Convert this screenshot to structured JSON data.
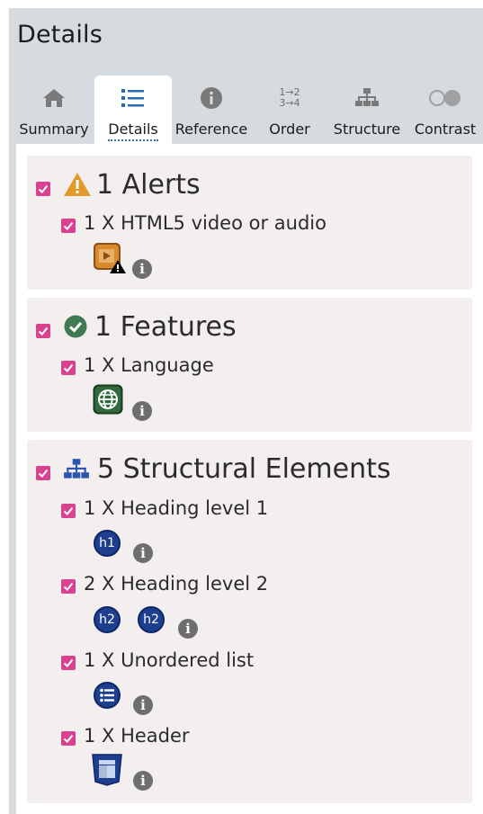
{
  "panel": {
    "title": "Details"
  },
  "tabs": [
    {
      "label": "Summary",
      "icon": "home-icon"
    },
    {
      "label": "Details",
      "icon": "list-icon",
      "active": true
    },
    {
      "label": "Reference",
      "icon": "info-icon"
    },
    {
      "label": "Order",
      "icon": "order-icon",
      "icon_text_top": "1→2",
      "icon_text_bottom": "3→4"
    },
    {
      "label": "Structure",
      "icon": "structure-icon"
    },
    {
      "label": "Contrast",
      "icon": "contrast-icon"
    }
  ],
  "sections": {
    "alerts": {
      "title": "1 Alerts",
      "items": [
        {
          "label": "1 X HTML5 video or audio",
          "icon": "video-alert-icon"
        }
      ]
    },
    "features": {
      "title": "1 Features",
      "items": [
        {
          "label": "1 X Language",
          "icon": "language-globe-icon"
        }
      ]
    },
    "structural": {
      "title": "5 Structural Elements",
      "items": [
        {
          "label": "1 X Heading level 1",
          "badges": [
            "h1"
          ]
        },
        {
          "label": "2 X Heading level 2",
          "badges": [
            "h2",
            "h2"
          ]
        },
        {
          "label": "1 X Unordered list",
          "icon": "unordered-list-icon"
        },
        {
          "label": "1 X Header",
          "icon": "header-icon"
        }
      ]
    }
  },
  "colors": {
    "checkbox": "#d9428f",
    "alert": "#e09a2a",
    "feature": "#3f7a55",
    "structure": "#1e3f8f"
  }
}
